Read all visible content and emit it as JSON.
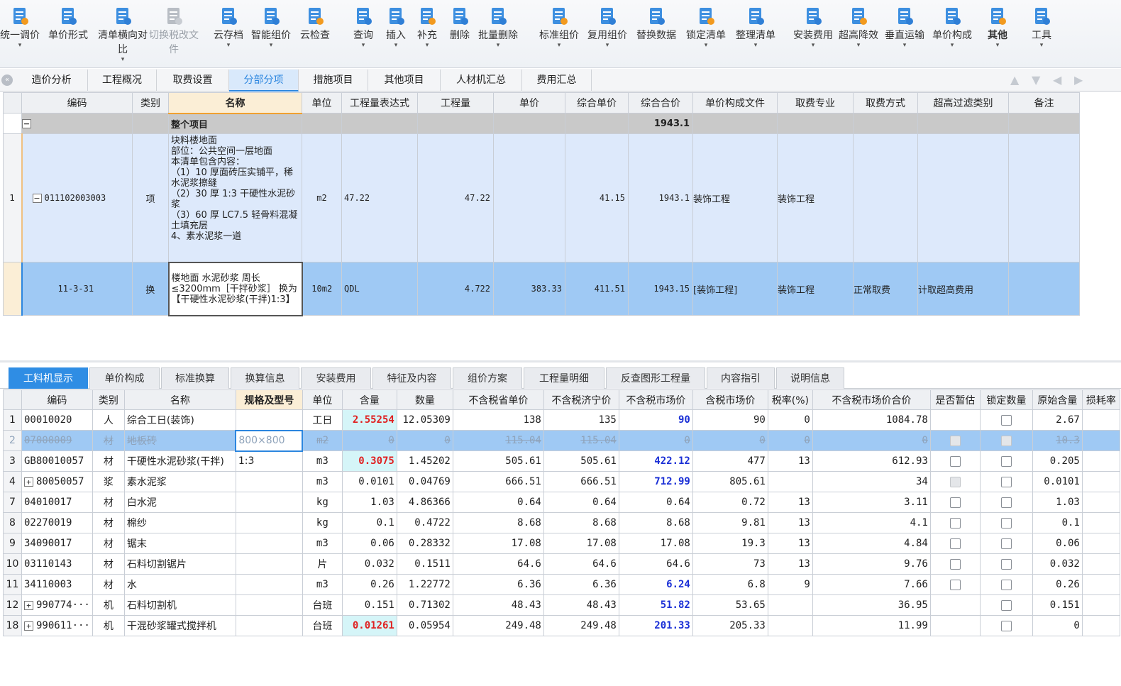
{
  "toolbar": [
    {
      "label": "统一调价",
      "icon": "adjust-price-icon",
      "arrow": true
    },
    {
      "label": "单价形式",
      "icon": "unit-price-form-icon",
      "arrow": false
    },
    {
      "label": "清单横向对比",
      "icon": "list-compare-icon",
      "arrow": true
    },
    {
      "label": "切换税改文件",
      "icon": "switch-tax-file-icon",
      "arrow": false,
      "disabled": true
    },
    {
      "label": "云存档",
      "icon": "cloud-save-icon",
      "arrow": true
    },
    {
      "label": "智能组价",
      "icon": "smart-pricing-icon",
      "arrow": true
    },
    {
      "label": "云检查",
      "icon": "cloud-check-icon",
      "arrow": false
    },
    {
      "label": "查询",
      "icon": "query-icon",
      "arrow": true
    },
    {
      "label": "插入",
      "icon": "insert-icon",
      "arrow": true
    },
    {
      "label": "补充",
      "icon": "supplement-icon",
      "arrow": true
    },
    {
      "label": "删除",
      "icon": "delete-icon",
      "arrow": false
    },
    {
      "label": "批量删除",
      "icon": "batch-delete-icon",
      "arrow": true
    },
    {
      "label": "标准组价",
      "icon": "standard-pricing-icon",
      "arrow": true
    },
    {
      "label": "复用组价",
      "icon": "reuse-pricing-icon",
      "arrow": true
    },
    {
      "label": "替换数据",
      "icon": "replace-data-icon",
      "arrow": false
    },
    {
      "label": "锁定清单",
      "icon": "lock-list-icon",
      "arrow": true
    },
    {
      "label": "整理清单",
      "icon": "organize-list-icon",
      "arrow": true
    },
    {
      "label": "安装费用",
      "icon": "install-fee-icon",
      "arrow": true
    },
    {
      "label": "超高降效",
      "icon": "high-reduce-icon",
      "arrow": true
    },
    {
      "label": "垂直运输",
      "icon": "vertical-transport-icon",
      "arrow": true
    },
    {
      "label": "单价构成",
      "icon": "price-composition-icon",
      "arrow": true
    },
    {
      "label": "其他",
      "icon": "other-icon",
      "arrow": true,
      "bold": true
    },
    {
      "label": "工具",
      "icon": "tools-icon",
      "arrow": true
    }
  ],
  "tabs_top": [
    "造价分析",
    "工程概况",
    "取费设置",
    "分部分项",
    "措施项目",
    "其他项目",
    "人材机汇总",
    "费用汇总"
  ],
  "active_top": "分部分项",
  "grid1": {
    "headers": [
      "编码",
      "类别",
      "名称",
      "单位",
      "工程量表达式",
      "工程量",
      "单价",
      "综合单价",
      "综合合价",
      "单价构成文件",
      "取费专业",
      "取费方式",
      "超高过滤类别",
      "备注"
    ],
    "row0": {
      "name": "整个项目",
      "total": "1943.1"
    },
    "row1": {
      "no": "1",
      "code": "011102003003",
      "type": "项",
      "name": "块料楼地面\n部位：公共空间一层地面\n本清单包含内容：\n（1）10 厚面砖压实铺平，稀水泥浆擦缝\n（2）30 厚 1:3 干硬性水泥砂浆\n（3）60 厚 LC7.5 轻骨料混凝土填充层\n4、素水泥浆一道",
      "unit": "m2",
      "expr": "47.22",
      "qty": "47.22",
      "price": "",
      "comp_price": "41.15",
      "comp_total": "1943.1",
      "file": "装饰工程",
      "major": "装饰工程",
      "method": "",
      "filter": "",
      "remark": ""
    },
    "row2": {
      "code": "11-3-31",
      "type": "换",
      "name": "楼地面 水泥砂浆 周长≤3200mm［干拌砂浆］ 换为【干硬性水泥砂浆(干拌)1:3】",
      "unit": "10m2",
      "expr": "QDL",
      "qty": "4.722",
      "price": "383.33",
      "comp_price": "411.51",
      "comp_total": "1943.15",
      "file": "[装饰工程]",
      "major": "装饰工程",
      "method": "正常取费",
      "filter": "计取超高费用",
      "remark": ""
    }
  },
  "tabs_bottom": [
    "工料机显示",
    "单价构成",
    "标准换算",
    "换算信息",
    "安装费用",
    "特征及内容",
    "组价方案",
    "工程量明细",
    "反查图形工程量",
    "内容指引",
    "说明信息"
  ],
  "active_bottom": "工料机显示",
  "grid2": {
    "headers": [
      "编码",
      "类别",
      "名称",
      "规格及型号",
      "单位",
      "含量",
      "数量",
      "不含税省单价",
      "不含税济宁价",
      "不含税市场价",
      "含税市场价",
      "税率(%)",
      "不含税市场价合价",
      "是否暂估",
      "锁定数量",
      "原始含量",
      "损耗率"
    ],
    "rows": [
      {
        "no": "1",
        "code": "00010020",
        "type": "人",
        "name": "综合工日(装饰)",
        "spec": "",
        "unit": "工日",
        "content": "2.55254",
        "qty": "12.05309",
        "prov": "138",
        "jn": "135",
        "market": "90",
        "market_tax": "90",
        "rate": "0",
        "total": "1084.78",
        "est": "",
        "lock": "box",
        "orig": "2.67",
        "loss": ""
      },
      {
        "no": "2",
        "code": "07000009",
        "type": "材",
        "name": "地板砖",
        "spec": "800×800",
        "unit": "m2",
        "content": "0",
        "qty": "0",
        "prov": "115.04",
        "jn": "115.04",
        "market": "0",
        "market_tax": "0",
        "rate": "0",
        "total": "0",
        "est": "box",
        "lock": "box",
        "orig": "10.3",
        "loss": ""
      },
      {
        "no": "3",
        "code": "GB80010057",
        "type": "材",
        "name": "干硬性水泥砂浆(干拌)",
        "spec": "1:3",
        "unit": "m3",
        "content": "0.3075",
        "qty": "1.45202",
        "prov": "505.61",
        "jn": "505.61",
        "market": "422.12",
        "market_tax": "477",
        "rate": "13",
        "total": "612.93",
        "est": "box",
        "lock": "box",
        "orig": "0.205",
        "loss": ""
      },
      {
        "no": "4",
        "code": "80050057",
        "type": "浆",
        "name": "素水泥浆",
        "spec": "",
        "unit": "m3",
        "content": "0.0101",
        "qty": "0.04769",
        "prov": "666.51",
        "jn": "666.51",
        "market": "712.99",
        "market_tax": "805.61",
        "rate": "",
        "total": "34",
        "est": "dis",
        "lock": "box",
        "orig": "0.0101",
        "loss": "",
        "plus": true
      },
      {
        "no": "7",
        "code": "04010017",
        "type": "材",
        "name": "白水泥",
        "spec": "",
        "unit": "kg",
        "content": "1.03",
        "qty": "4.86366",
        "prov": "0.64",
        "jn": "0.64",
        "market": "0.64",
        "market_tax": "0.72",
        "rate": "13",
        "total": "3.11",
        "est": "box",
        "lock": "box",
        "orig": "1.03",
        "loss": ""
      },
      {
        "no": "8",
        "code": "02270019",
        "type": "材",
        "name": "棉纱",
        "spec": "",
        "unit": "kg",
        "content": "0.1",
        "qty": "0.4722",
        "prov": "8.68",
        "jn": "8.68",
        "market": "8.68",
        "market_tax": "9.81",
        "rate": "13",
        "total": "4.1",
        "est": "box",
        "lock": "box",
        "orig": "0.1",
        "loss": ""
      },
      {
        "no": "9",
        "code": "34090017",
        "type": "材",
        "name": "锯末",
        "spec": "",
        "unit": "m3",
        "content": "0.06",
        "qty": "0.28332",
        "prov": "17.08",
        "jn": "17.08",
        "market": "17.08",
        "market_tax": "19.3",
        "rate": "13",
        "total": "4.84",
        "est": "box",
        "lock": "box",
        "orig": "0.06",
        "loss": ""
      },
      {
        "no": "10",
        "code": "03110143",
        "type": "材",
        "name": "石料切割锯片",
        "spec": "",
        "unit": "片",
        "content": "0.032",
        "qty": "0.1511",
        "prov": "64.6",
        "jn": "64.6",
        "market": "64.6",
        "market_tax": "73",
        "rate": "13",
        "total": "9.76",
        "est": "box",
        "lock": "box",
        "orig": "0.032",
        "loss": ""
      },
      {
        "no": "11",
        "code": "34110003",
        "type": "材",
        "name": "水",
        "spec": "",
        "unit": "m3",
        "content": "0.26",
        "qty": "1.22772",
        "prov": "6.36",
        "jn": "6.36",
        "market": "6.24",
        "market_tax": "6.8",
        "rate": "9",
        "total": "7.66",
        "est": "box",
        "lock": "box",
        "orig": "0.26",
        "loss": ""
      },
      {
        "no": "12",
        "code": "990774···",
        "type": "机",
        "name": "石料切割机",
        "spec": "",
        "unit": "台班",
        "content": "0.151",
        "qty": "0.71302",
        "prov": "48.43",
        "jn": "48.43",
        "market": "51.82",
        "market_tax": "53.65",
        "rate": "",
        "total": "36.95",
        "est": "",
        "lock": "box",
        "orig": "0.151",
        "loss": "",
        "plus": true
      },
      {
        "no": "18",
        "code": "990611···",
        "type": "机",
        "name": "干混砂浆罐式搅拌机",
        "spec": "",
        "unit": "台班",
        "content": "0.01261",
        "qty": "0.05954",
        "prov": "249.48",
        "jn": "249.48",
        "market": "201.33",
        "market_tax": "205.33",
        "rate": "",
        "total": "11.99",
        "est": "",
        "lock": "box",
        "orig": "0",
        "loss": "",
        "plus": true
      }
    ]
  },
  "colors": {
    "accent": "#2c86df",
    "selected_row": "#9fc9f4",
    "group_row": "#c9c9c9",
    "red_value": "#e02020",
    "blue_value": "#1a2fd6"
  }
}
